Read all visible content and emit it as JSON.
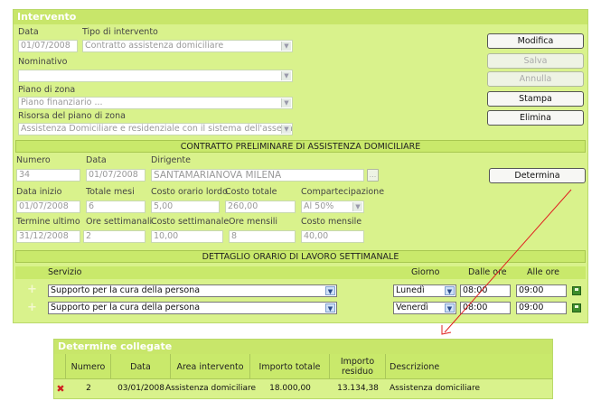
{
  "panel_title": "Intervento",
  "labels": {
    "data": "Data",
    "tipo": "Tipo di intervento",
    "nominativo": "Nominativo",
    "piano": "Piano di zona",
    "risorsa": "Risorsa del piano di zona"
  },
  "values": {
    "data": "01/07/2008",
    "tipo": "Contratto assistenza domiciliare",
    "nominativo": "",
    "piano": "Piano finanziario ...",
    "risorsa": "Assistenza Domiciliare e residenziale con il sistema dell'assegno"
  },
  "buttons": {
    "modifica": "Modifica",
    "salva": "Salva",
    "annulla": "Annulla",
    "stampa": "Stampa",
    "elimina": "Elimina",
    "determina": "Determina",
    "ellipsis": "..."
  },
  "contratto": {
    "title": "CONTRATTO PRELIMINARE DI ASSISTENZA DOMICILIARE",
    "labels": {
      "numero": "Numero",
      "data": "Data",
      "dirigente": "Dirigente",
      "data_inizio": "Data inizio",
      "totale_mesi": "Totale mesi",
      "costo_orario": "Costo orario lordo",
      "costo_totale": "Costo totale",
      "compartecipazione": "Compartecipazione",
      "termine": "Termine ultimo",
      "ore_sett": "Ore settimanali",
      "costo_sett": "Costo settimanale",
      "ore_mensili": "Ore mensili",
      "costo_mensile": "Costo mensile"
    },
    "values": {
      "numero": "34",
      "data": "01/07/2008",
      "dirigente": "SANTAMARIANOVA MILENA",
      "data_inizio": "01/07/2008",
      "totale_mesi": "6",
      "costo_orario": "5,00",
      "costo_totale": "260,00",
      "compartecipazione": "Al 50%",
      "termine": "31/12/2008",
      "ore_sett": "2",
      "costo_sett": "10,00",
      "ore_mensili": "8",
      "costo_mensile": "40,00"
    }
  },
  "dettaglio": {
    "title": "DETTAGLIO ORARIO DI LAVORO SETTIMANALE",
    "headers": {
      "servizio": "Servizio",
      "giorno": "Giorno",
      "dalle": "Dalle ore",
      "alle": "Alle ore"
    },
    "rows": [
      {
        "servizio": "Supporto per la cura della persona",
        "giorno": "Lunedì",
        "dalle": "08:00",
        "alle": "09:00"
      },
      {
        "servizio": "Supporto per la cura della persona",
        "giorno": "Venerdì",
        "dalle": "08:00",
        "alle": "09:00"
      }
    ]
  },
  "determine": {
    "title": "Determine collegate",
    "headers": {
      "numero": "Numero",
      "data": "Data",
      "area": "Area intervento",
      "importo_totale": "Importo totale",
      "importo_residuo": "Importo residuo",
      "descrizione": "Descrizione"
    },
    "rows": [
      {
        "numero": "2",
        "data": "03/01/2008",
        "area": "Assistenza domiciliare",
        "importo_totale": "18.000,00",
        "importo_residuo": "13.134,38",
        "descrizione": "Assistenza domiciliare"
      }
    ]
  },
  "colors": {
    "panel_bg": "#d9f28c",
    "header_band": "#c9e96b",
    "arrow": "#e02020"
  }
}
